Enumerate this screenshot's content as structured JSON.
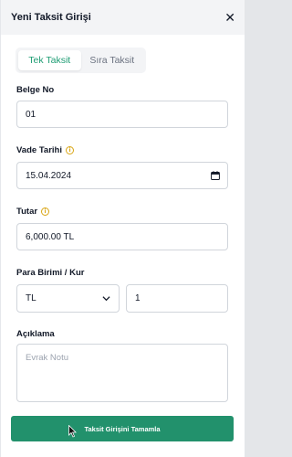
{
  "header": {
    "title": "Yeni Taksit Girişi",
    "close_icon": "close-icon"
  },
  "tabs": [
    {
      "label": "Tek Taksit",
      "active": true
    },
    {
      "label": "Sıra Taksit",
      "active": false
    }
  ],
  "form": {
    "belge_no": {
      "label": "Belge No",
      "value": "01"
    },
    "vade_tarihi": {
      "label": "Vade Tarihi",
      "value": "15.04.2024",
      "icon": "info-icon"
    },
    "tutar": {
      "label": "Tutar",
      "value": "6,000.00 TL",
      "icon": "info-icon"
    },
    "para_birimi": {
      "label": "Para Birimi / Kur",
      "currency": "TL",
      "rate": "1"
    },
    "aciklama": {
      "label": "Açıklama",
      "placeholder": "Evrak Notu",
      "value": ""
    }
  },
  "submit_label": "Taksit Girişini Tamamla",
  "colors": {
    "accent": "#1f9d74",
    "button": "#22916c",
    "info": "#d9a514"
  }
}
